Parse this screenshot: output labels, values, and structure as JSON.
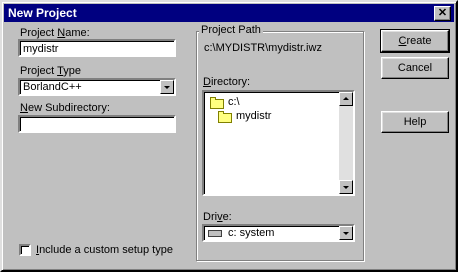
{
  "window": {
    "title": "New Project",
    "close_label": "✕"
  },
  "project_name": {
    "label_pre": "Project ",
    "label_key": "N",
    "label_post": "ame:",
    "value": "mydistr"
  },
  "project_type": {
    "label_pre": "Project ",
    "label_key": "T",
    "label_post": "ype",
    "value": "BorlandC++"
  },
  "new_subdirectory": {
    "label_pre": "",
    "label_key": "N",
    "label_post": "ew Subdirectory:",
    "value": ""
  },
  "project_path": {
    "group_label": "Project Path",
    "value": "c:\\MYDISTR\\mydistr.iwz"
  },
  "directory": {
    "label_pre": "",
    "label_key": "D",
    "label_post": "irectory:",
    "items": [
      {
        "label": "c:\\"
      },
      {
        "label": "mydistr"
      }
    ]
  },
  "drive": {
    "label_pre": "Dri",
    "label_key": "v",
    "label_post": "e:",
    "value": "c: system"
  },
  "buttons": {
    "create": {
      "pre": "",
      "key": "C",
      "post": "reate"
    },
    "cancel": "Cancel",
    "help": "Help"
  },
  "custom_setup": {
    "label_pre": "",
    "label_key": "I",
    "label_post": "nclude a custom setup type",
    "checked": false
  }
}
